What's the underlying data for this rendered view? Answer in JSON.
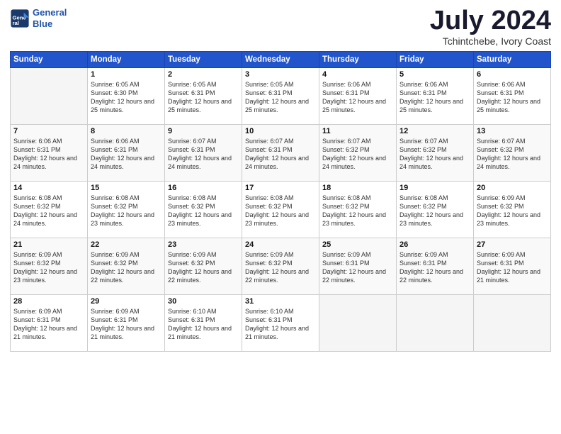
{
  "header": {
    "logo_line1": "General",
    "logo_line2": "Blue",
    "month_year": "July 2024",
    "location": "Tchintchebe, Ivory Coast"
  },
  "days_of_week": [
    "Sunday",
    "Monday",
    "Tuesday",
    "Wednesday",
    "Thursday",
    "Friday",
    "Saturday"
  ],
  "weeks": [
    [
      {
        "day": "",
        "sunrise": "",
        "sunset": "",
        "daylight": "",
        "empty": true
      },
      {
        "day": "1",
        "sunrise": "Sunrise: 6:05 AM",
        "sunset": "Sunset: 6:30 PM",
        "daylight": "Daylight: 12 hours and 25 minutes."
      },
      {
        "day": "2",
        "sunrise": "Sunrise: 6:05 AM",
        "sunset": "Sunset: 6:31 PM",
        "daylight": "Daylight: 12 hours and 25 minutes."
      },
      {
        "day": "3",
        "sunrise": "Sunrise: 6:05 AM",
        "sunset": "Sunset: 6:31 PM",
        "daylight": "Daylight: 12 hours and 25 minutes."
      },
      {
        "day": "4",
        "sunrise": "Sunrise: 6:06 AM",
        "sunset": "Sunset: 6:31 PM",
        "daylight": "Daylight: 12 hours and 25 minutes."
      },
      {
        "day": "5",
        "sunrise": "Sunrise: 6:06 AM",
        "sunset": "Sunset: 6:31 PM",
        "daylight": "Daylight: 12 hours and 25 minutes."
      },
      {
        "day": "6",
        "sunrise": "Sunrise: 6:06 AM",
        "sunset": "Sunset: 6:31 PM",
        "daylight": "Daylight: 12 hours and 25 minutes."
      }
    ],
    [
      {
        "day": "7",
        "sunrise": "Sunrise: 6:06 AM",
        "sunset": "Sunset: 6:31 PM",
        "daylight": "Daylight: 12 hours and 24 minutes."
      },
      {
        "day": "8",
        "sunrise": "Sunrise: 6:06 AM",
        "sunset": "Sunset: 6:31 PM",
        "daylight": "Daylight: 12 hours and 24 minutes."
      },
      {
        "day": "9",
        "sunrise": "Sunrise: 6:07 AM",
        "sunset": "Sunset: 6:31 PM",
        "daylight": "Daylight: 12 hours and 24 minutes."
      },
      {
        "day": "10",
        "sunrise": "Sunrise: 6:07 AM",
        "sunset": "Sunset: 6:31 PM",
        "daylight": "Daylight: 12 hours and 24 minutes."
      },
      {
        "day": "11",
        "sunrise": "Sunrise: 6:07 AM",
        "sunset": "Sunset: 6:32 PM",
        "daylight": "Daylight: 12 hours and 24 minutes."
      },
      {
        "day": "12",
        "sunrise": "Sunrise: 6:07 AM",
        "sunset": "Sunset: 6:32 PM",
        "daylight": "Daylight: 12 hours and 24 minutes."
      },
      {
        "day": "13",
        "sunrise": "Sunrise: 6:07 AM",
        "sunset": "Sunset: 6:32 PM",
        "daylight": "Daylight: 12 hours and 24 minutes."
      }
    ],
    [
      {
        "day": "14",
        "sunrise": "Sunrise: 6:08 AM",
        "sunset": "Sunset: 6:32 PM",
        "daylight": "Daylight: 12 hours and 24 minutes."
      },
      {
        "day": "15",
        "sunrise": "Sunrise: 6:08 AM",
        "sunset": "Sunset: 6:32 PM",
        "daylight": "Daylight: 12 hours and 23 minutes."
      },
      {
        "day": "16",
        "sunrise": "Sunrise: 6:08 AM",
        "sunset": "Sunset: 6:32 PM",
        "daylight": "Daylight: 12 hours and 23 minutes."
      },
      {
        "day": "17",
        "sunrise": "Sunrise: 6:08 AM",
        "sunset": "Sunset: 6:32 PM",
        "daylight": "Daylight: 12 hours and 23 minutes."
      },
      {
        "day": "18",
        "sunrise": "Sunrise: 6:08 AM",
        "sunset": "Sunset: 6:32 PM",
        "daylight": "Daylight: 12 hours and 23 minutes."
      },
      {
        "day": "19",
        "sunrise": "Sunrise: 6:08 AM",
        "sunset": "Sunset: 6:32 PM",
        "daylight": "Daylight: 12 hours and 23 minutes."
      },
      {
        "day": "20",
        "sunrise": "Sunrise: 6:09 AM",
        "sunset": "Sunset: 6:32 PM",
        "daylight": "Daylight: 12 hours and 23 minutes."
      }
    ],
    [
      {
        "day": "21",
        "sunrise": "Sunrise: 6:09 AM",
        "sunset": "Sunset: 6:32 PM",
        "daylight": "Daylight: 12 hours and 23 minutes."
      },
      {
        "day": "22",
        "sunrise": "Sunrise: 6:09 AM",
        "sunset": "Sunset: 6:32 PM",
        "daylight": "Daylight: 12 hours and 22 minutes."
      },
      {
        "day": "23",
        "sunrise": "Sunrise: 6:09 AM",
        "sunset": "Sunset: 6:32 PM",
        "daylight": "Daylight: 12 hours and 22 minutes."
      },
      {
        "day": "24",
        "sunrise": "Sunrise: 6:09 AM",
        "sunset": "Sunset: 6:32 PM",
        "daylight": "Daylight: 12 hours and 22 minutes."
      },
      {
        "day": "25",
        "sunrise": "Sunrise: 6:09 AM",
        "sunset": "Sunset: 6:31 PM",
        "daylight": "Daylight: 12 hours and 22 minutes."
      },
      {
        "day": "26",
        "sunrise": "Sunrise: 6:09 AM",
        "sunset": "Sunset: 6:31 PM",
        "daylight": "Daylight: 12 hours and 22 minutes."
      },
      {
        "day": "27",
        "sunrise": "Sunrise: 6:09 AM",
        "sunset": "Sunset: 6:31 PM",
        "daylight": "Daylight: 12 hours and 21 minutes."
      }
    ],
    [
      {
        "day": "28",
        "sunrise": "Sunrise: 6:09 AM",
        "sunset": "Sunset: 6:31 PM",
        "daylight": "Daylight: 12 hours and 21 minutes."
      },
      {
        "day": "29",
        "sunrise": "Sunrise: 6:09 AM",
        "sunset": "Sunset: 6:31 PM",
        "daylight": "Daylight: 12 hours and 21 minutes."
      },
      {
        "day": "30",
        "sunrise": "Sunrise: 6:10 AM",
        "sunset": "Sunset: 6:31 PM",
        "daylight": "Daylight: 12 hours and 21 minutes."
      },
      {
        "day": "31",
        "sunrise": "Sunrise: 6:10 AM",
        "sunset": "Sunset: 6:31 PM",
        "daylight": "Daylight: 12 hours and 21 minutes."
      },
      {
        "day": "",
        "sunrise": "",
        "sunset": "",
        "daylight": "",
        "empty": true
      },
      {
        "day": "",
        "sunrise": "",
        "sunset": "",
        "daylight": "",
        "empty": true
      },
      {
        "day": "",
        "sunrise": "",
        "sunset": "",
        "daylight": "",
        "empty": true
      }
    ]
  ]
}
